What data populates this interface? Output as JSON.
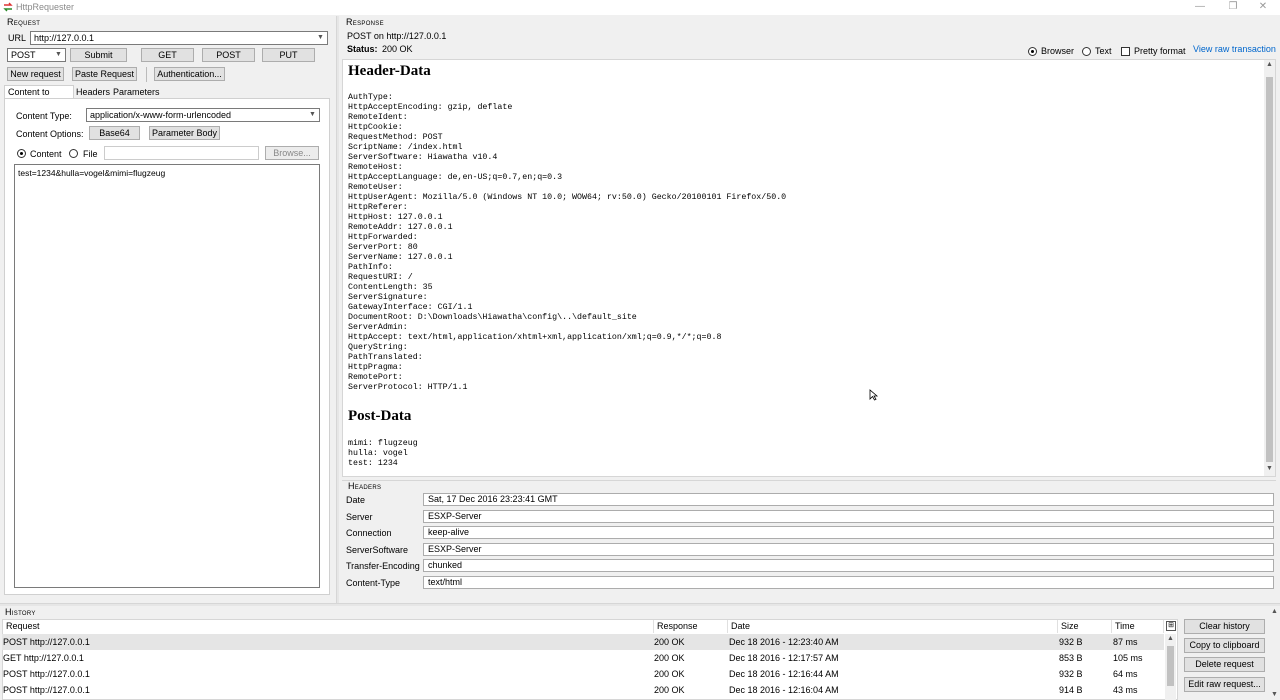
{
  "window": {
    "title": "HttpRequester",
    "minimize": "—",
    "restore": "❐",
    "close": "✕"
  },
  "request": {
    "section_title": "Request",
    "url_label": "URL",
    "url_value": "http://127.0.0.1",
    "method_value": "POST",
    "submit_label": "Submit",
    "get_label": "GET",
    "post_label": "POST",
    "put_label": "PUT",
    "new_request_label": "New request",
    "paste_request_label": "Paste Request",
    "authentication_label": "Authentication...",
    "tabs": [
      "Content to Send",
      "Headers",
      "Parameters"
    ],
    "content_type_label": "Content Type:",
    "content_type_value": "application/x-www-form-urlencoded",
    "content_options_label": "Content Options:",
    "base64_label": "Base64",
    "parameter_body_label": "Parameter Body",
    "content_radio_label": "Content",
    "file_radio_label": "File",
    "browse_label": "Browse...",
    "body_text": "test=1234&hulla=vogel&mimi=flugzeug"
  },
  "response": {
    "section_title": "Response",
    "summary": "POST on http://127.0.0.1",
    "status_label": "Status:",
    "status_value": "200 OK",
    "browser_label": "Browser",
    "text_label": "Text",
    "pretty_label": "Pretty format",
    "view_raw_label": "View raw transaction",
    "header_data_title": "Header-Data",
    "header_data_lines": [
      "AuthType:",
      "HttpAcceptEncoding: gzip, deflate",
      "RemoteIdent:",
      "HttpCookie:",
      "RequestMethod: POST",
      "ScriptName: /index.html",
      "ServerSoftware: Hiawatha v10.4",
      "RemoteHost:",
      "HttpAcceptLanguage: de,en-US;q=0.7,en;q=0.3",
      "RemoteUser:",
      "HttpUserAgent: Mozilla/5.0 (Windows NT 10.0; WOW64; rv:50.0) Gecko/20100101 Firefox/50.0",
      "HttpReferer:",
      "HttpHost: 127.0.0.1",
      "RemoteAddr: 127.0.0.1",
      "HttpForwarded:",
      "ServerPort: 80",
      "ServerName: 127.0.0.1",
      "PathInfo:",
      "RequestURI: /",
      "ContentLength: 35",
      "ServerSignature:",
      "GatewayInterface: CGI/1.1",
      "DocumentRoot: D:\\Downloads\\Hiawatha\\config\\..\\default_site",
      "ServerAdmin:",
      "HttpAccept: text/html,application/xhtml+xml,application/xml;q=0.9,*/*;q=0.8",
      "QueryString:",
      "PathTranslated:",
      "HttpPragma:",
      "RemotePort:",
      "ServerProtocol: HTTP/1.1"
    ],
    "post_data_title": "Post-Data",
    "post_data_lines": [
      "mimi: flugzeug",
      "hulla: vogel",
      "test: 1234"
    ]
  },
  "headers": {
    "section_title": "Headers",
    "rows": [
      {
        "name": "Date",
        "value": "Sat, 17 Dec 2016 23:23:41 GMT"
      },
      {
        "name": "Server",
        "value": "ESXP-Server"
      },
      {
        "name": "Connection",
        "value": "keep-alive"
      },
      {
        "name": "ServerSoftware",
        "value": "ESXP-Server"
      },
      {
        "name": "Transfer-Encoding",
        "value": "chunked"
      },
      {
        "name": "Content-Type",
        "value": "text/html"
      }
    ]
  },
  "history": {
    "section_title": "History",
    "columns": [
      "Request",
      "Response",
      "Date",
      "Size",
      "Time"
    ],
    "rows": [
      {
        "request": "POST http://127.0.0.1",
        "response": "200 OK",
        "date": "Dec 18 2016 - 12:23:40 AM",
        "size": "932 B",
        "time": "87 ms"
      },
      {
        "request": "GET http://127.0.0.1",
        "response": "200 OK",
        "date": "Dec 18 2016 - 12:17:57 AM",
        "size": "853 B",
        "time": "105 ms"
      },
      {
        "request": "POST http://127.0.0.1",
        "response": "200 OK",
        "date": "Dec 18 2016 - 12:16:44 AM",
        "size": "932 B",
        "time": "64 ms"
      },
      {
        "request": "POST http://127.0.0.1",
        "response": "200 OK",
        "date": "Dec 18 2016 - 12:16:04 AM",
        "size": "914 B",
        "time": "43 ms"
      }
    ],
    "clear_label": "Clear history",
    "copy_label": "Copy to clipboard",
    "delete_label": "Delete request",
    "edit_label": "Edit raw request..."
  },
  "colors": {
    "link": "#0066cc",
    "selected_row": "#e5e5e5"
  }
}
